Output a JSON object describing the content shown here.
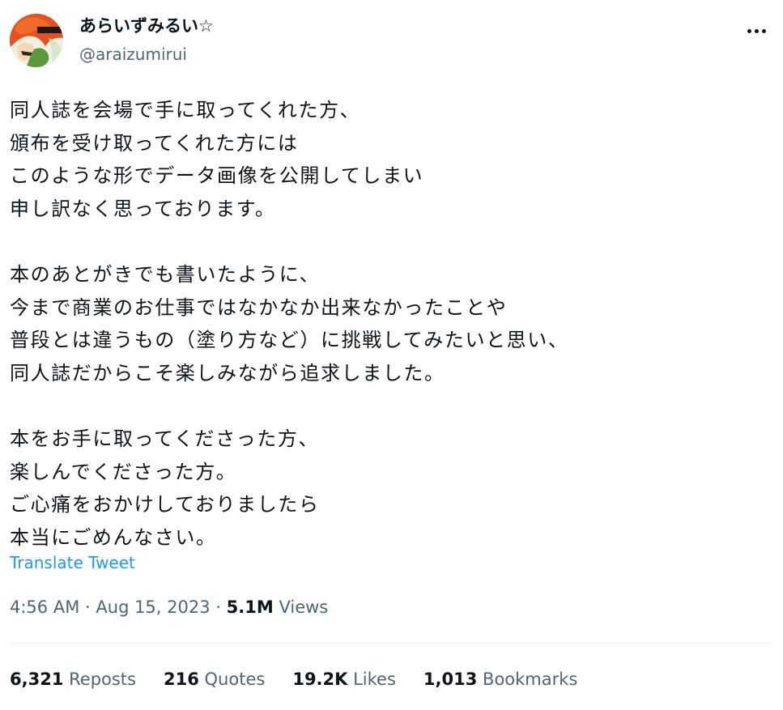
{
  "author": {
    "display_name": "あらいずみるい☆",
    "handle": "@araizumirui",
    "avatar_icon": "avatar-image"
  },
  "more_icon": "more-horizontal-icon",
  "tweet": {
    "lines": [
      "同人誌を会場で手に取ってくれた方、",
      "頒布を受け取ってくれた方には",
      "このような形でデータ画像を公開してしまい",
      "申し訳なく思っております。",
      "",
      "本のあとがきでも書いたように、",
      "今まで商業のお仕事ではなかなか出来なかったことや",
      "普段とは違うもの（塗り方など）に挑戦してみたいと思い、",
      "同人誌だからこそ楽しみながら追求しました。",
      "",
      "本をお手に取ってくださった方、",
      "楽しんでくださった方。",
      "ご心痛をおかけしておりましたら",
      "本当にごめんなさい。"
    ],
    "translate_label": "Translate Tweet"
  },
  "meta": {
    "time": "4:56 AM",
    "separator": "·",
    "date": "Aug 15, 2023",
    "views_count": "5.1M",
    "views_label": "Views"
  },
  "stats": {
    "reposts_count": "6,321",
    "reposts_label": "Reposts",
    "quotes_count": "216",
    "quotes_label": "Quotes",
    "likes_count": "19.2K",
    "likes_label": "Likes",
    "bookmarks_count": "1,013",
    "bookmarks_label": "Bookmarks"
  },
  "colors": {
    "text": "#0f1419",
    "secondary": "#536471",
    "link": "#1d9bf0",
    "divider": "#eff3f4",
    "avatar_accent": "#e8501e"
  }
}
